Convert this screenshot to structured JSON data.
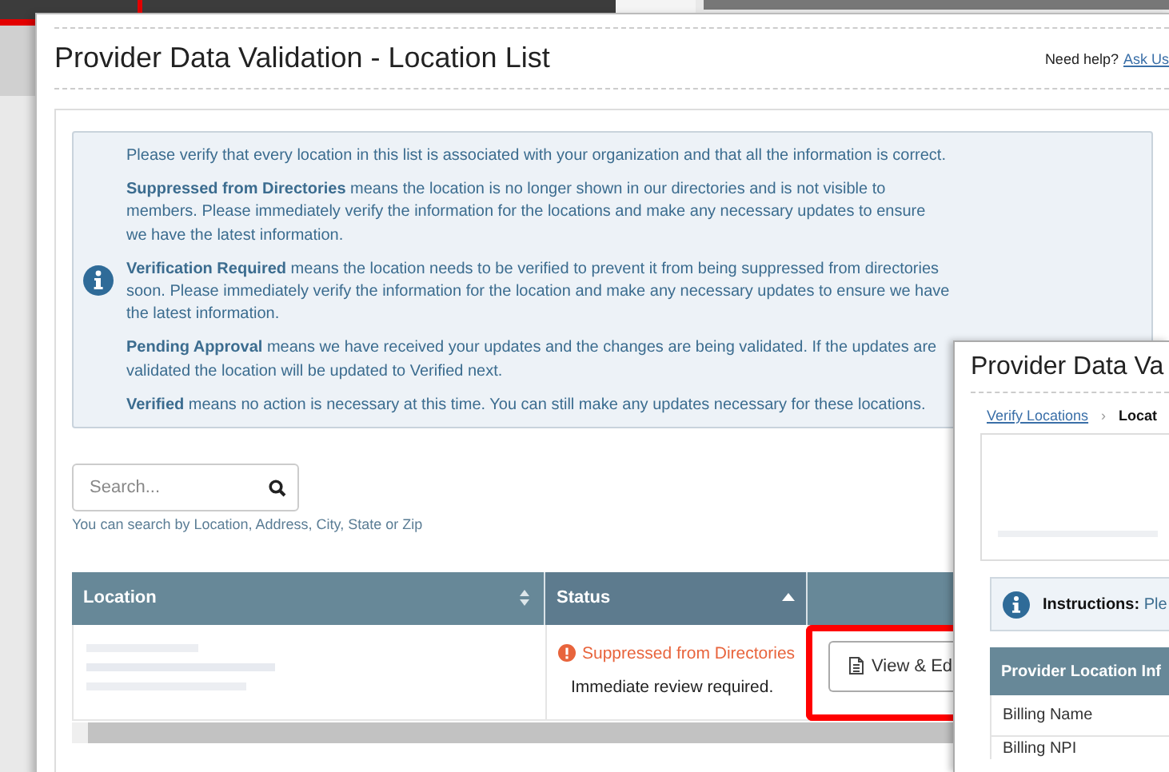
{
  "main_window": {
    "title": "Provider Data Validation - Location List",
    "help_text": "Need help?",
    "help_link": "Ask Us",
    "info": {
      "paragraphs": [
        "Please verify that every location in this list is associated with your organization and that all the information is correct.",
        "**Suppressed from Directories** means the location is no longer shown in our directories and is not visible to members.   Please immediately verify the information for the locations and make any necessary updates to ensure we have the latest information.",
        "**Verification Required** means the location needs to be verified to prevent it from being suppressed from directories soon.  Please immediately verify the information for the location and make any necessary updates to ensure we have the latest information.",
        "**Pending Approval** means we have received your updates and the changes are being validated.  If the updates are validated the location will be updated to Verified next.",
        "**Verified** means no action is necessary at this time.  You can still make any updates necessary for these locations."
      ]
    },
    "search": {
      "placeholder": "Search...",
      "hint": "You can search by Location, Address, City, State or Zip"
    },
    "table": {
      "columns": [
        {
          "label": "Location",
          "sorted": false
        },
        {
          "label": "Status",
          "sorted": true
        }
      ],
      "rows": [
        {
          "status": "Suppressed from Directories",
          "status_note": "Immediate review required.",
          "action": "View & Ed",
          "highlighted": true
        }
      ]
    }
  },
  "detail_window": {
    "title": "Provider Data Va",
    "breadcrumbs": [
      {
        "label": "Verify Locations",
        "link": true
      },
      {
        "label": "Locat",
        "link": false
      }
    ],
    "separator": "›",
    "instructions": "**Instructions:** Ple",
    "table": {
      "header": "Provider Location Inf",
      "rows": [
        "Billing Name",
        "Billing NPI"
      ]
    }
  }
}
